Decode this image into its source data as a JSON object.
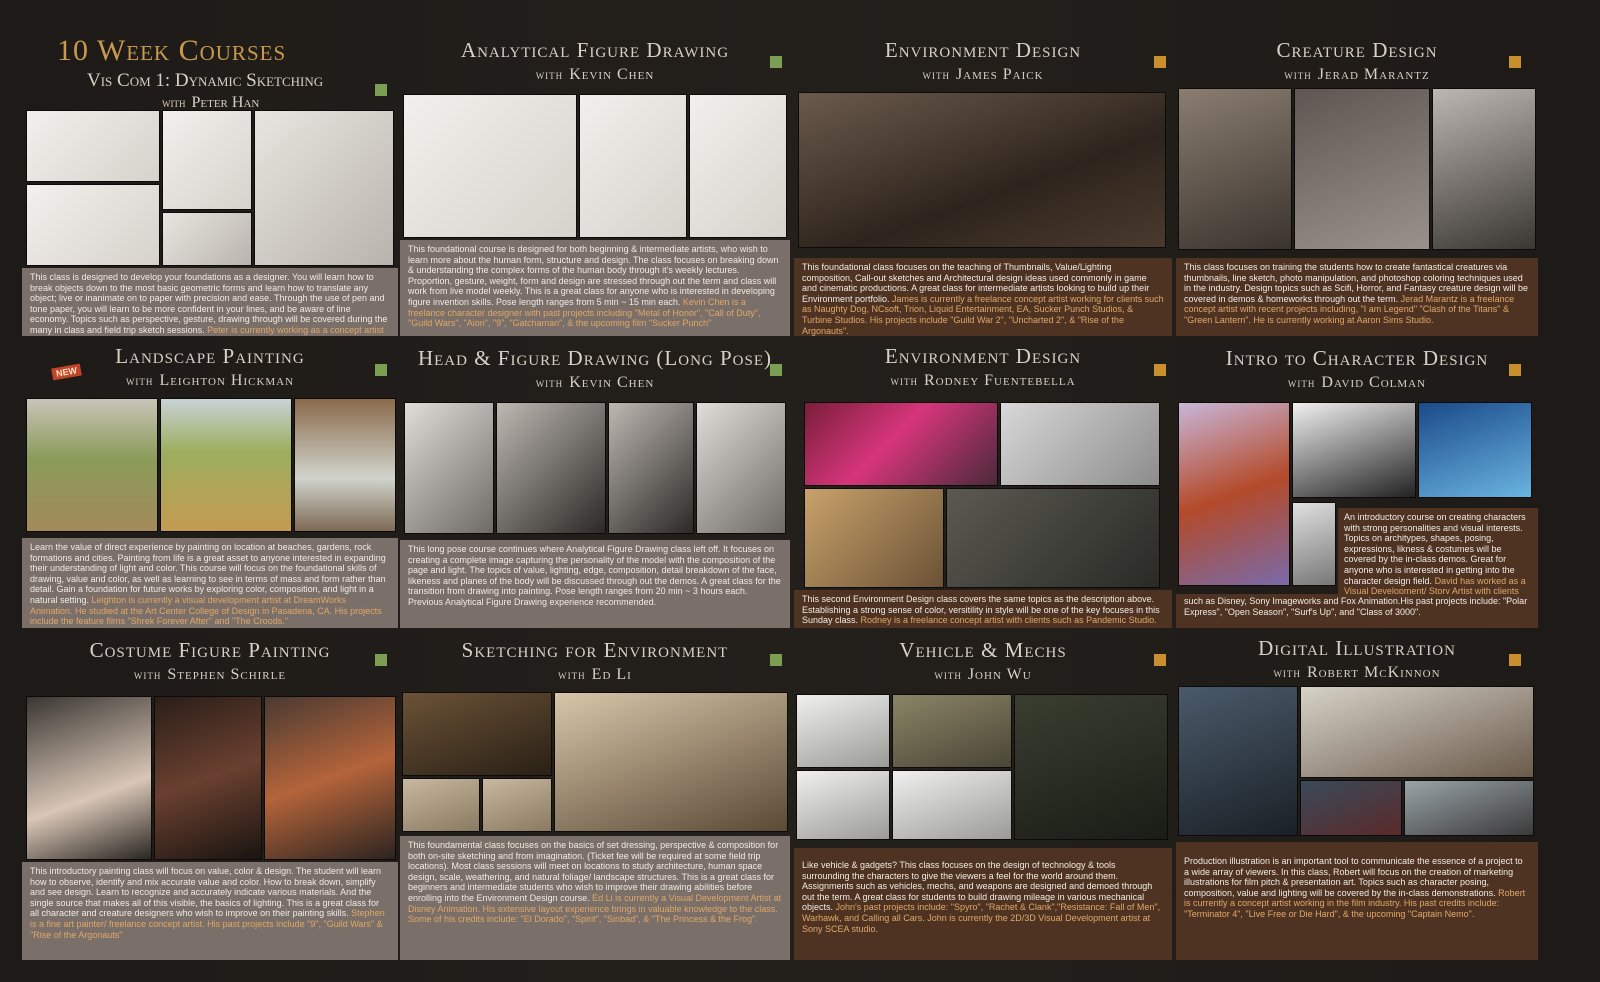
{
  "main_title": "10 Week Courses",
  "with_word": "with",
  "new_badge": "NEW",
  "courses": [
    {
      "title": "Vis Com 1: Dynamic Sketching",
      "instructor": "Peter Han",
      "text": "This class is designed to develop your foundations as a designer. You will learn how to break objects down to the most basic geometric forms and learn how to translate any object; live or inanimate on to paper with precision and ease. Through the use of pen and tone paper, you will learn to be more confident in your lines, and be aware of line economy. Topics such as perspective, gesture, drawing through will be covered during the many in class and field trip sketch sessions. ",
      "highlight": "Peter is currently working as a concept artist at Trion World Network.",
      "text_after": ""
    },
    {
      "title": "Analytical Figure Drawing",
      "instructor": "Kevin Chen",
      "text": "This foundational course is designed for both beginning & intermediate artists, who wish to learn more about the human form, structure and design. The class focuses on breaking down & understanding the complex forms of the human body through it's weekly lectures. Proportion, gesture, weight, form and design are stressed through out the term and class will work from live model weekly. This is a great class for anyone who is interested in developing figure invention skills. Pose length ranges from 5 min ~ 15 min each. ",
      "highlight": "Kevin Chen is a freelance character designer with past projects including \"Metal of Honor\", \"Call of Duty\", \"Guild Wars\", \"Aion\", \"9\", \"Gatchaman\", & the upcoming film \"Sucker Punch\"",
      "text_after": ""
    },
    {
      "title": "Environment Design",
      "instructor": "James Paick",
      "text": "This foundational class focuses on the teaching of Thumbnails, Value/Lighting composition, Call-out sketches and Architectural design ideas used commonly in game and cinematic productions. A great class for intermediate artists looking to build up their Environment portfolio. ",
      "highlight": "James is currently a freelance concept artist working for clients such as Naughty Dog, NCsoft, Trion, Liquid Entertainment, EA, Sucker Punch Studios, & Turbine Studios. His projects include \"Guild War 2\", \"Uncharted 2\", & \"Rise of the Argonauts\".",
      "text_after": ""
    },
    {
      "title": "Creature Design",
      "instructor": "Jerad Marantz",
      "text": "This class focuses on training the students how to create fantastical creatures via thumbnails, line sketch, photo manipulation, and photoshop coloring techniques used in the industry. Design topics such as Scifi, Horror, and Fantasy creature design will be covered in demos & homeworks through out the term. ",
      "highlight": "Jerad Marantz is a freelance concept artist with recent projects including, \"I am Legend\" \"Clash of the Titans\" & \"Green Lantern\". He is currently working at Aaron Sims Studio.",
      "text_after": ""
    },
    {
      "title": "Landscape Painting",
      "instructor": "Leighton Hickman",
      "text": "Learn the value of direct experience by painting on location at beaches, gardens, rock formations and cities. Painting from life is a great asset to anyone interested in expanding their understanding of light and color. This course will focus on the foundational skills of drawing, value and color, as well as learning to see in terms of mass and form rather than detail. Gain a foundation for future works by exploring color, composition, and light in a natural setting. ",
      "highlight": "Leighton is currently a visual development artist at DreamWorks Animation. He studied at the Art Center College of Design in Pasadena, CA. His projects include the feature films \"Shrek Forever After\" and \"The Croods.\"",
      "text_after": ""
    },
    {
      "title": "Head & Figure Drawing (Long Pose)",
      "instructor": "Kevin Chen",
      "text": "This long pose course continues where Analytical Figure Drawing class left off. It focuses on creating a complete image capturing the personality of the model with the composition of the page and light. The topics of value, lighting, edge, composition, detail breakdown of the face, likeness and planes of the body will be discussed through out the demos. A great class for the transition from drawing into painting. Pose length ranges from 20 min ~ 3 hours each. Previous Analytical Figure Drawing experience recommended.",
      "highlight": "",
      "text_after": ""
    },
    {
      "title": "Environment Design",
      "instructor": "Rodney Fuentebella",
      "text": "This second Environment Design class covers the same topics as the description above. Establishing a strong sense of color, versitility in style will be one of the key focuses in this Sunday class. ",
      "highlight": "Rodney is a freelance concept artist with clients such as Pandemic Studio.",
      "text_after": ""
    },
    {
      "title": "Intro to Character Design",
      "instructor": "David Colman",
      "text": "An introductory course on creating characters with strong personalities and visual interests. Topics on architypes, shapes, posing, expressions, likness & costumes will be covered by the in-class demos. Great for anyone who is interested in getting into the character design field. ",
      "highlight": "David has worked as a Visual Development/ Story Artist with clients",
      "text_after": "such as Disney, Sony Imageworks and Fox Animation.His past projects include: \"Polar Express\", \"Open Season\", \"Surf's Up\", and \"Class of 3000\"."
    },
    {
      "title": "Costume Figure Painting",
      "instructor": "Stephen Schirle",
      "text": "This introductory painting class will focus on value, color & design. The student will learn how to observe, identify and mix accurate value and color. How to break down, simplify and see design. Learn to recognize and accurately indicate various materials. And the single source that makes all of this visible, the basics of lighting. This is a great class for all character and creature designers who wish to improve on their painting skills. ",
      "highlight": "Stephen is a fine art painter/ freelance concept artist. His past projects include \"9\", \"Guild Wars\" & \"Rise of the Argonauts\"",
      "text_after": ""
    },
    {
      "title": "Sketching for Environment",
      "instructor": "Ed Li",
      "text": "This foundamental class focuses on the basics of set dressing, perspective & composition for both on-site sketching and from imagination. (Ticket fee will be required at some field trip locations). Most class sessions will meet on locations to study architecture, human space design, scale, weathering, and natural foliage/ landscape structures. This is a great class for beginners and intermediate students who wish to improve their drawing abilities before enrolling into the Environment Design course. ",
      "highlight": "Ed Li is currently a Visual Development Artist at Disney Animation. His extensive layout experience brings in valuable knowledge to the class. Some of his credits include: \"El Dorado\", \"Spirit\", \"Sinbad\", & \"The Princess & the Frog\".",
      "text_after": ""
    },
    {
      "title": "Vehicle & Mechs",
      "instructor": "John Wu",
      "text": "Like vehicle & gadgets? This class focuses on the design of technology & tools surrounding the characters to give the viewers a feel for the world around them. Assignments such as vehicles, mechs, and weapons are designed and demoed through out the term. A great class for students to build drawing mileage in various mechanical objects. ",
      "highlight": "John's past projects include: \"Spyro\", \"Rachet & Clank\",\"Resistance: Fall of Men\", Warhawk, and Calling all Cars. John is currently the 2D/3D Visual Development artist at Sony SCEA studio.",
      "text_after": ""
    },
    {
      "title": "Digital Illustration",
      "instructor": "Robert McKinnon",
      "text": "Production illustration is an important tool to communicate the essence of a project to a wide array of viewers. In this class, Robert will focus on the creation of marketing illustrations for film pitch & presentation art. Topics such as character posing, composition, value and lighting will be covered by the in-class demonstrations. ",
      "highlight": "Robert is currently a concept artist working in the film industry. His past credits include: \"Terminator 4\", \"Live Free or Die Hard\", & the upcoming \"Captain Nemo\".",
      "text_after": ""
    }
  ],
  "colors": {
    "accent_green": "#7a9e52",
    "accent_orange": "#c98f2e",
    "highlight": "#e0a868"
  }
}
